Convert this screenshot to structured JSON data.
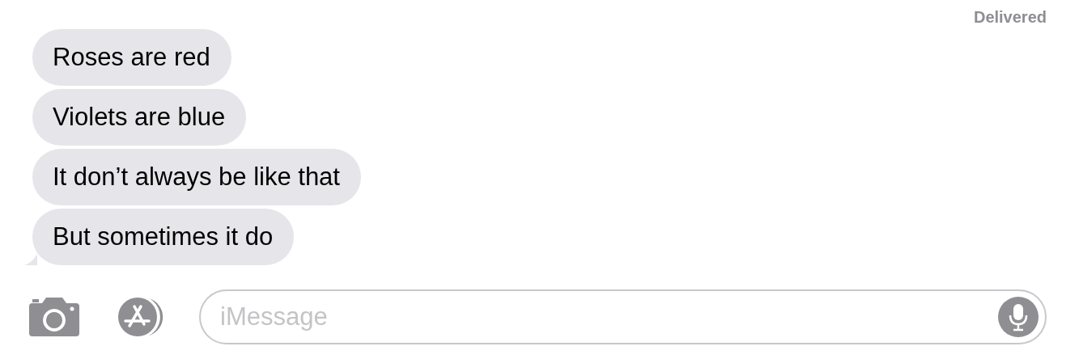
{
  "status": "Delivered",
  "messages": [
    {
      "text": "Roses are red",
      "tail": false
    },
    {
      "text": "Violets are blue",
      "tail": false
    },
    {
      "text": "It don’t always be like that",
      "tail": false
    },
    {
      "text": "But sometimes it do",
      "tail": true
    }
  ],
  "composer": {
    "placeholder": "iMessage"
  }
}
